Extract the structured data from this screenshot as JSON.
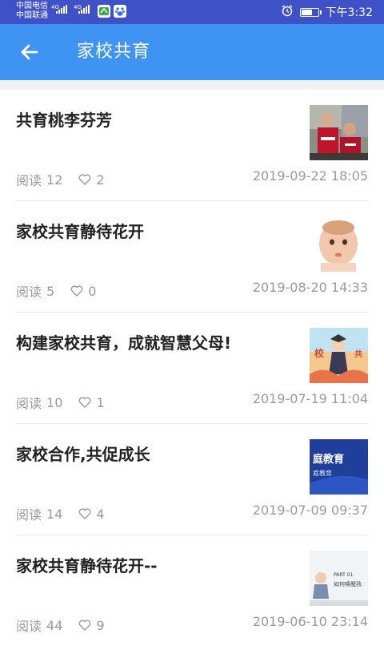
{
  "status_bar": {
    "carrier1": "中国电信",
    "carrier2": "中国联通",
    "net1": "4G",
    "net2": "4G",
    "time": "下午3:32",
    "battery_level": 0.7
  },
  "appbar": {
    "title": "家校共育",
    "back_icon": "arrow-left-icon"
  },
  "articles": [
    {
      "title": "共育桃李芬芳",
      "read_label": "阅读",
      "reads": "12",
      "likes": "2",
      "date": "2019-09-22 18:05",
      "thumb_desc": "photo-children"
    },
    {
      "title": "家校共育静待花开",
      "read_label": "阅读",
      "reads": "5",
      "likes": "0",
      "date": "2019-08-20 14:33",
      "thumb_desc": "photo-baby"
    },
    {
      "title": "构建家校共育，成就智慧父母!",
      "read_label": "阅读",
      "reads": "10",
      "likes": "1",
      "date": "2019-07-19 11:04",
      "thumb_desc": "illustration-graduate",
      "thumb_text1": "校",
      "thumb_text2": "共"
    },
    {
      "title": "家校合作,共促成长",
      "read_label": "阅读",
      "reads": "14",
      "likes": "4",
      "date": "2019-07-09 09:37",
      "thumb_desc": "banner-blue",
      "thumb_text1": "庭教育",
      "thumb_text2": "庭教育"
    },
    {
      "title": "家校共育静待花开--",
      "read_label": "阅读",
      "reads": "44",
      "likes": "9",
      "date": "2019-06-10 23:14",
      "thumb_desc": "slide-illustration",
      "thumb_text1": "PART 01",
      "thumb_text2": "如何唤醒孩"
    }
  ]
}
